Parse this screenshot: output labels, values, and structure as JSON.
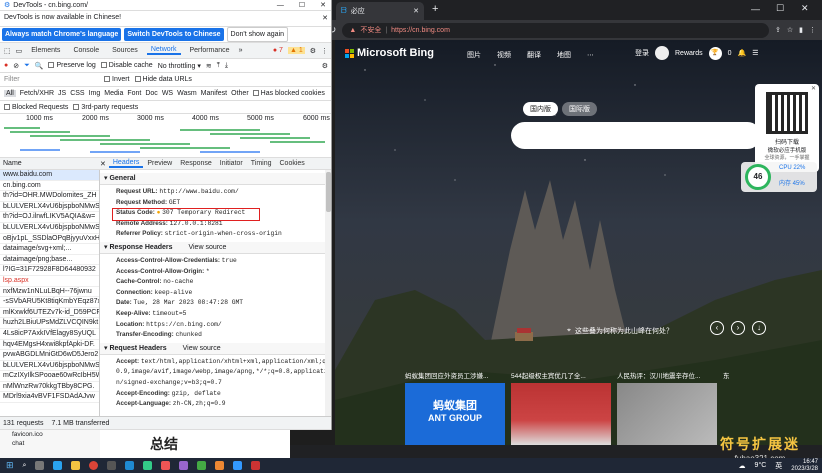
{
  "devtools": {
    "title": "DevTools - cn.bing.com/",
    "banner_text": "DevTools is now available in Chinese!",
    "banner_btn1": "Always match Chrome's language",
    "banner_btn2": "Switch DevTools to Chinese",
    "banner_btn3": "Don't show again",
    "tabs": [
      "Elements",
      "Console",
      "Sources",
      "Network",
      "Performance"
    ],
    "error_count": "7",
    "warn_count": "1",
    "toolbar": {
      "preserve": "Preserve log",
      "disable_cache": "Disable cache",
      "throttle": "No throttling"
    },
    "filter": {
      "placeholder": "Filter",
      "invert": "Invert",
      "hide_data": "Hide data URLs"
    },
    "types": [
      "All",
      "Fetch/XHR",
      "JS",
      "CSS",
      "Img",
      "Media",
      "Font",
      "Doc",
      "WS",
      "Wasm",
      "Manifest",
      "Other"
    ],
    "blocked_cookies": "Has blocked cookies",
    "blocked_requests": "Blocked Requests",
    "third_party": "3rd-party requests",
    "ticks": [
      "1000 ms",
      "2000 ms",
      "3000 ms",
      "4000 ms",
      "5000 ms",
      "6000 ms"
    ],
    "name_header": "Name",
    "requests": [
      "www.baidu.com",
      "cn.bing.com",
      "th?id=OHR.MWDolomites_ZH",
      "bLULVERLX4vU6bjspboNMwS",
      "th?id=OJ.ilrwfLIKV5AQIA&w=",
      "bLULVERLX4vU6bjspboNMwS",
      "oBjv1pL_SSDlaOPqBjyyuVxxH",
      "dataimage/svg+xml;...",
      "dataimage/png;base...",
      "l?IG=31F72928F8D64480932",
      "lsp.aspx",
      "nxfMzw1nNLuLBqH--76jwnu",
      "-sSVbARU5Kt8tiqKmbYEqz87x",
      "mlKxwkf6UTEZv7k-id_D59PCF",
      "huzh2LBiuUPsMdZLVCQIN9kt",
      "4Ls8icP7AxkIVfElagy8SyUQL",
      "hqv4EMgsH4xwi8kpfApki-DF.",
      "pvwABGDLMniGtD6wD5Jero2",
      "bLULVERLX4vU6bjspboNMwS",
      "mCzIXyIlkSPooae60wRcIbH5W",
      "nMlWnzRw70kkgTBby8CPG.",
      "MDrl9xia4vBVF1FSDAdAJvw"
    ],
    "request_red": "lsp.aspx",
    "status_summary": "131 requests",
    "transferred": "7.1 MB transferred",
    "sub_tabs": [
      "Headers",
      "Preview",
      "Response",
      "Initiator",
      "Timing",
      "Cookies"
    ],
    "general_title": "General",
    "general": [
      {
        "k": "Request URL:",
        "v": "http://www.baidu.com/"
      },
      {
        "k": "Request Method:",
        "v": "GET"
      },
      {
        "k": "Status Code:",
        "v": "307 Temporary Redirect"
      },
      {
        "k": "Remote Address:",
        "v": "127.0.0.1:8281"
      },
      {
        "k": "Referrer Policy:",
        "v": "strict-origin-when-cross-origin"
      }
    ],
    "response_title": "Response Headers",
    "view_source": "View source",
    "response": [
      {
        "k": "Access-Control-Allow-Credentials:",
        "v": "true"
      },
      {
        "k": "Access-Control-Allow-Origin:",
        "v": "*"
      },
      {
        "k": "Cache-Control:",
        "v": "no-cache"
      },
      {
        "k": "Connection:",
        "v": "keep-alive"
      },
      {
        "k": "Date:",
        "v": "Tue, 28 Mar 2023 08:47:28 GMT"
      },
      {
        "k": "Keep-Alive:",
        "v": "timeout=5"
      },
      {
        "k": "Location:",
        "v": "https://cn.bing.com/"
      },
      {
        "k": "Transfer-Encoding:",
        "v": "chunked"
      }
    ],
    "request_title": "Request Headers",
    "request_h": [
      {
        "k": "Accept:",
        "v": "text/html,application/xhtml+xml,application/xml;q="
      },
      {
        "k": "",
        "v": "0.9,image/avif,image/webp,image/apng,*/*;q=0.8,applicatio"
      },
      {
        "k": "",
        "v": "n/signed-exchange;v=b3;q=0.7"
      },
      {
        "k": "Accept-Encoding:",
        "v": "gzip, deflate"
      },
      {
        "k": "Accept-Language:",
        "v": "zh-CN,zh;q=0.9"
      }
    ]
  },
  "browser": {
    "tab_title": "必应",
    "insecure": "不安全",
    "url": "https://cn.bing.com",
    "logo": "Microsoft Bing",
    "nav": [
      "图片",
      "视频",
      "翻译",
      "地图"
    ],
    "login": "登录",
    "rewards": "Rewards",
    "rewards_count": "0",
    "region_tabs": [
      "国内版",
      "国际版"
    ],
    "qr_caption1": "扫码下载",
    "qr_caption2": "微软必应手机版",
    "qr_caption3": "全球资源，一手掌握",
    "cpu": "CPU 22%",
    "mem": "内存 45%",
    "gauge": "46",
    "location_text": "这些叠为何称为此山峰在何处？",
    "news": [
      "蚂蚁集团回应外资员工涉嫌...",
      "544起级权主宾优几了全...",
      "人民热评：汉川地震辛存位...",
      "东"
    ],
    "ant_text1": "蚂蚁集团",
    "ant_text2": "ANT GROUP"
  },
  "behind": {
    "favicon": "favicon.ico",
    "chat": "chat",
    "heading": "总结"
  },
  "watermark": {
    "line1": "符号扩展迷",
    "line2": "fuhao321.com"
  },
  "taskbar": {
    "weather": "9°C",
    "time": "16:47",
    "date": "2023/3/28",
    "lang": "英"
  }
}
